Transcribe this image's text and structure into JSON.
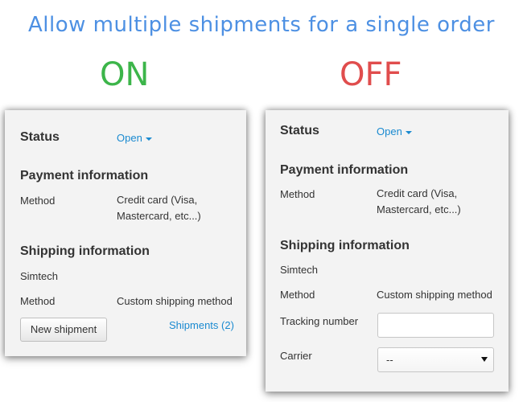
{
  "headline": "Allow multiple shipments for a single order",
  "on_panel": {
    "mode_label": "ON",
    "status_label": "Status",
    "status_value": "Open",
    "payment_heading": "Payment information",
    "payment_method_label": "Method",
    "payment_method_value": "Credit card (Visa, Mastercard, etc...)",
    "shipping_heading": "Shipping information",
    "carrier_name": "Simtech",
    "shipping_method_label": "Method",
    "shipping_method_value": "Custom shipping method",
    "new_shipment_button": "New shipment",
    "shipments_link": "Shipments (2)"
  },
  "off_panel": {
    "mode_label": "OFF",
    "status_label": "Status",
    "status_value": "Open",
    "payment_heading": "Payment information",
    "payment_method_label": "Method",
    "payment_method_value": "Credit card (Visa, Mastercard, etc...)",
    "shipping_heading": "Shipping information",
    "carrier_name": "Simtech",
    "shipping_method_label": "Method",
    "shipping_method_value": "Custom shipping method",
    "tracking_label": "Tracking number",
    "tracking_value": "",
    "carrier_label": "Carrier",
    "carrier_select_value": "--"
  },
  "colors": {
    "headline": "#4d90e3",
    "on": "#3cb54a",
    "off": "#e04d4d",
    "link": "#1a8ad0",
    "panel_bg": "#f3f3f3"
  },
  "icons": {
    "status_dropdown": "caret-down-icon",
    "carrier_dropdown": "triangle-down-icon"
  }
}
